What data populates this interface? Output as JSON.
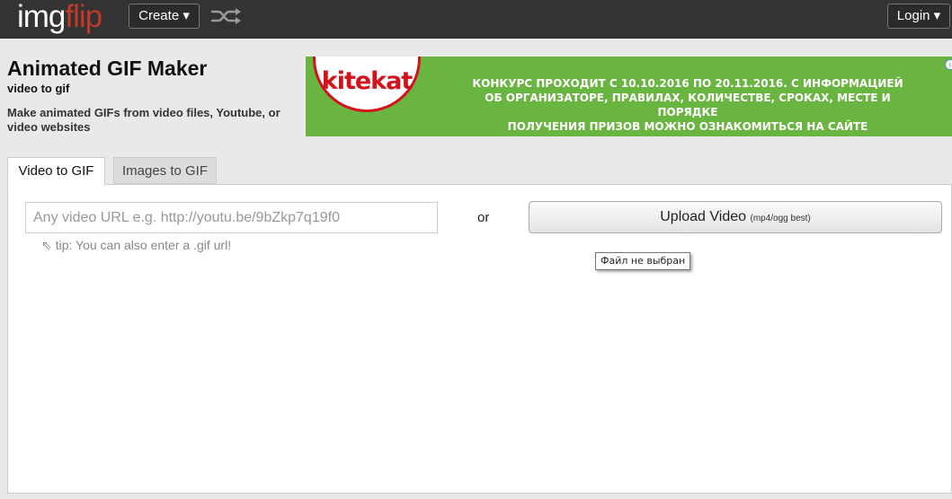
{
  "nav": {
    "logo_img": "img",
    "logo_flip": "flip",
    "create_label": "Create ▾",
    "shuffle_icon": "shuffle-icon",
    "login_label": "Login ▾"
  },
  "header": {
    "title": "Animated GIF Maker",
    "subtitle": "video to gif",
    "description": "Make animated GIFs from video files, Youtube, or video websites"
  },
  "ad": {
    "brand": "kitekat",
    "lines": [
      "КОНКУРС ПРОХОДИТ С 10.10.2016 ПО 20.11.2016. С ИНФОРМАЦИЕЙ",
      "ОБ ОРГАНИЗАТОРЕ, ПРАВИЛАХ, КОЛИЧЕСТВЕ, СРОКАХ, МЕСТЕ И ПОРЯДКЕ",
      "ПОЛУЧЕНИЯ ПРИЗОВ МОЖНО ОЗНАКОМИТЬСЯ НА САЙТЕ WWW.KITEKAT.RU"
    ],
    "background_color": "#6ab542",
    "brand_color": "#d3121c"
  },
  "tabs": [
    {
      "label": "Video to GIF",
      "active": true
    },
    {
      "label": "Images to GIF",
      "active": false
    }
  ],
  "form": {
    "url_placeholder": "Any video URL e.g. http://youtu.be/9bZkp7q19f0",
    "url_value": "",
    "tip_arrow": "⇖",
    "tip": "tip: You can also enter a .gif url!",
    "or_label": "or",
    "upload_label": "Upload Video",
    "upload_hint": "(mp4/ogg best)",
    "file_tooltip": "Файл не выбран"
  },
  "colors": {
    "topbar": "#333333",
    "logo_accent": "#c0392b",
    "page_bg": "#e9e9e9"
  }
}
